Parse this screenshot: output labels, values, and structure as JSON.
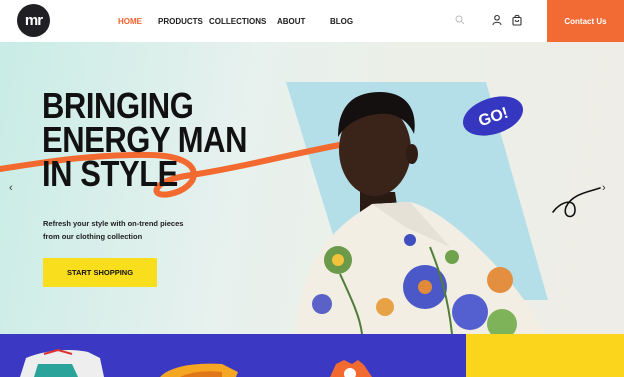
{
  "brand": {
    "logo_text": "mr"
  },
  "nav": {
    "home": "HOME",
    "products": "PRODUCTS",
    "collections": "COLLECTIONS",
    "about": "ABOUT",
    "blog": "BLOG"
  },
  "header": {
    "contact_label": "Contact Us",
    "icons": [
      "search-icon",
      "user-icon",
      "cart-icon"
    ]
  },
  "hero": {
    "title_lines": [
      "BRINGING",
      "ENERGY MAN",
      "IN STYLE"
    ],
    "subtitle_line1": "Refresh your style with on-trend pieces",
    "subtitle_line2": "from our clothing collection",
    "cta_label": "START SHOPPING",
    "sticker_text": "GO!",
    "prev_arrow": "‹",
    "next_arrow": "›"
  },
  "colors": {
    "accent_orange": "#f26b35",
    "cta_yellow": "#f9de1d",
    "sticker_blue": "#3637c0",
    "strip_blue": "#3b39c4",
    "strip_yellow": "#fbd41c"
  }
}
